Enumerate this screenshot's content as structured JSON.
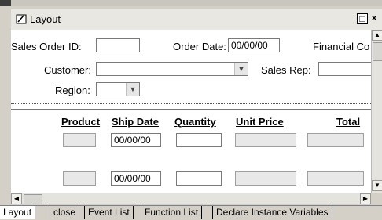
{
  "window": {
    "title": "Layout",
    "minimize_label": "□",
    "close_label": "×"
  },
  "header_fields": {
    "sales_order_id": {
      "label": "Sales Order ID:",
      "value": ""
    },
    "order_date": {
      "label": "Order Date:",
      "value": "00/00/00"
    },
    "financial_code": {
      "label": "Financial Co"
    },
    "customer": {
      "label": "Customer:",
      "value": ""
    },
    "sales_rep": {
      "label": "Sales Rep:",
      "value": ""
    },
    "region": {
      "label": "Region:",
      "value": ""
    }
  },
  "detail": {
    "columns": [
      "Product",
      "Ship Date",
      "Quantity",
      "Unit Price",
      "Total"
    ],
    "rows": [
      {
        "product": "",
        "ship_date": "00/00/00",
        "quantity": "",
        "unit_price": "",
        "total": ""
      },
      {
        "product": "",
        "ship_date": "00/00/00",
        "quantity": "",
        "unit_price": "",
        "total": ""
      }
    ]
  },
  "tabs": [
    {
      "label": "Layout",
      "active": true
    },
    {
      "label": "close",
      "active": false
    },
    {
      "label": "Event List",
      "active": false
    },
    {
      "label": "Function List",
      "active": false
    },
    {
      "label": "Declare Instance Variables",
      "active": false
    }
  ],
  "icons": {
    "app": "layout-pen-icon",
    "dropdown": "chevron-down-icon",
    "scroll_up": "arrow-up-icon",
    "scroll_down": "arrow-down-icon",
    "scroll_left": "arrow-left-icon",
    "scroll_right": "arrow-right-icon"
  }
}
